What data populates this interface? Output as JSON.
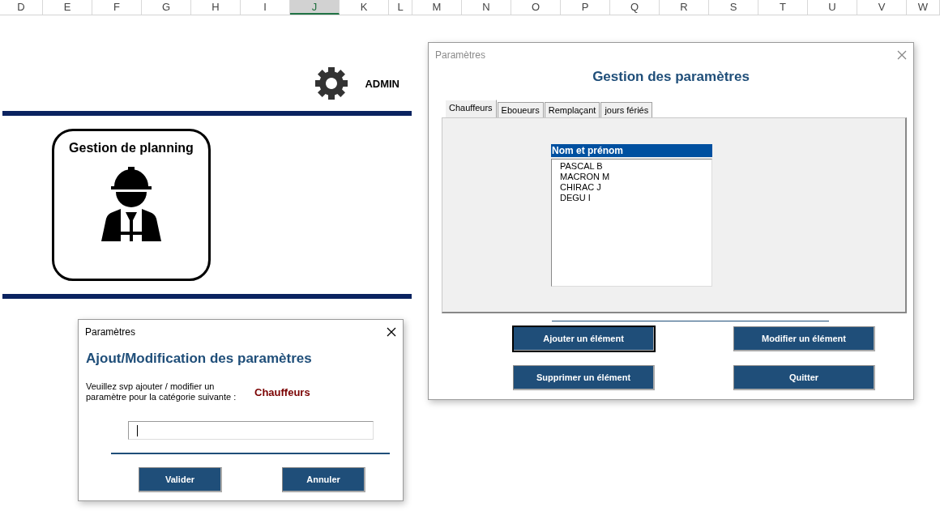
{
  "sheet": {
    "columns": [
      {
        "label": "D",
        "selected": false
      },
      {
        "label": "E",
        "selected": false
      },
      {
        "label": "F",
        "selected": false
      },
      {
        "label": "G",
        "selected": false
      },
      {
        "label": "H",
        "selected": false
      },
      {
        "label": "I",
        "selected": false
      },
      {
        "label": "J",
        "selected": true
      },
      {
        "label": "K",
        "selected": false
      },
      {
        "label": "L",
        "selected": false
      },
      {
        "label": "M",
        "selected": false
      },
      {
        "label": "N",
        "selected": false
      },
      {
        "label": "O",
        "selected": false
      },
      {
        "label": "P",
        "selected": false
      },
      {
        "label": "Q",
        "selected": false
      },
      {
        "label": "R",
        "selected": false
      },
      {
        "label": "S",
        "selected": false
      },
      {
        "label": "T",
        "selected": false
      },
      {
        "label": "U",
        "selected": false
      },
      {
        "label": "V",
        "selected": false
      },
      {
        "label": "W",
        "selected": false
      }
    ],
    "admin_label": "ADMIN",
    "tile": {
      "title": "Gestion de planning"
    }
  },
  "settings_dialog": {
    "title": "Paramètres",
    "active": false,
    "heading": "Gestion des paramètres",
    "tabs": [
      {
        "label": "Chauffeurs",
        "selected": true
      },
      {
        "label": "Eboueurs",
        "selected": false
      },
      {
        "label": "Remplaçant",
        "selected": false
      },
      {
        "label": "jours fériés",
        "selected": false
      }
    ],
    "list": {
      "header": "Nom et prénom",
      "items": [
        "PASCAL B",
        "MACRON M",
        "CHIRAC J",
        "DEGU I"
      ]
    },
    "buttons": [
      {
        "label": "Ajouter un élément",
        "focused": true
      },
      {
        "label": "Modifier un élément",
        "focused": false
      },
      {
        "label": "Supprimer un élément",
        "focused": false
      },
      {
        "label": "Quitter",
        "focused": false
      }
    ]
  },
  "edit_dialog": {
    "title": "Paramètres",
    "active": true,
    "heading": "Ajout/Modification des paramètres",
    "prompt": "Veuillez svp ajouter / modifier un paramètre pour la catégorie suivante :",
    "category": "Chauffeurs",
    "buttons": [
      {
        "label": "Valider",
        "focused": false
      },
      {
        "label": "Annuler",
        "focused": false
      }
    ]
  }
}
